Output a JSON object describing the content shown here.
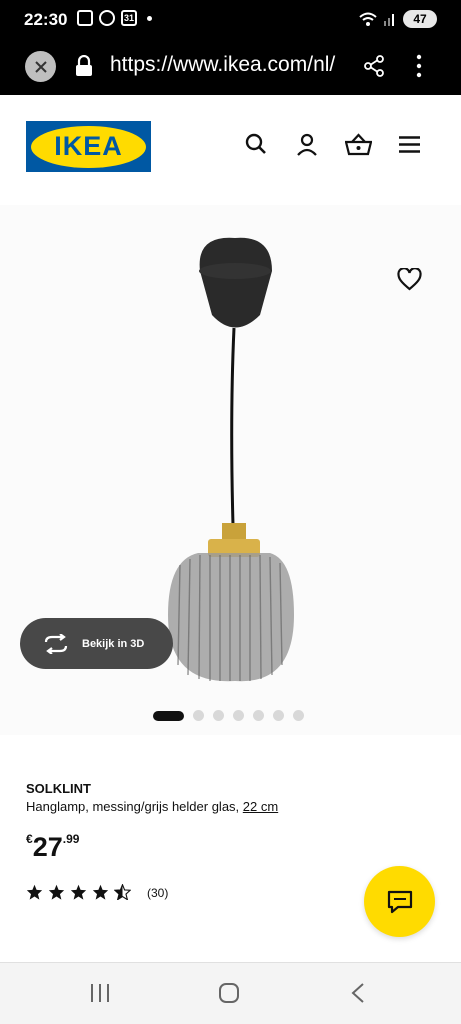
{
  "status_bar": {
    "time": "22:30",
    "calendar_day": "31",
    "battery": "47"
  },
  "browser": {
    "url": "https://www.ikea.com/nl/"
  },
  "header": {
    "logo_text": "IKEA"
  },
  "gallery": {
    "view3d_label": "Bekijk in 3D",
    "image_count": 7,
    "active_index": 1
  },
  "product": {
    "name": "SOLKLINT",
    "description": "Hanglamp, messing/grijs helder glas,",
    "size": "22 cm",
    "currency": "€",
    "price_int": "27",
    "price_dec": ".99",
    "rating": 4.5,
    "review_count": "(30)"
  },
  "colors": {
    "ikea_blue": "#0058a3",
    "ikea_yellow": "#ffdb00"
  }
}
